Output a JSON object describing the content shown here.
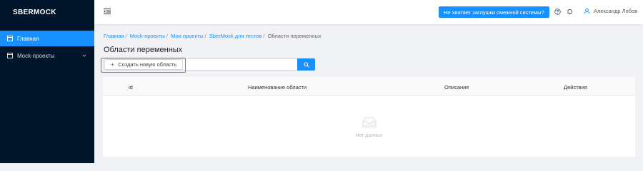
{
  "sidebar": {
    "logo": "SBERMOCK",
    "items": [
      {
        "label": "Главная",
        "icon": "home-icon",
        "active": true
      },
      {
        "label": "Mock-проекты",
        "icon": "folder-icon",
        "active": false
      }
    ]
  },
  "header": {
    "alert_button": "Не хватает заглушки смежной системы?",
    "user_name": "Александр Лобов"
  },
  "breadcrumb": {
    "items": [
      "Главная",
      "Mock-проекты",
      "Мои проекты",
      "SberMock для тестов"
    ],
    "current": "Области переменных"
  },
  "page": {
    "title": "Области переменных",
    "create_button": "Создать новую область",
    "search_placeholder": ""
  },
  "table": {
    "columns": [
      "id",
      "Наименование области",
      "Описание",
      "Действия"
    ],
    "empty_text": "Нет данных"
  },
  "colors": {
    "sidebar_bg": "#001529",
    "accent": "#1890ff",
    "highlight": "#d9534f"
  }
}
